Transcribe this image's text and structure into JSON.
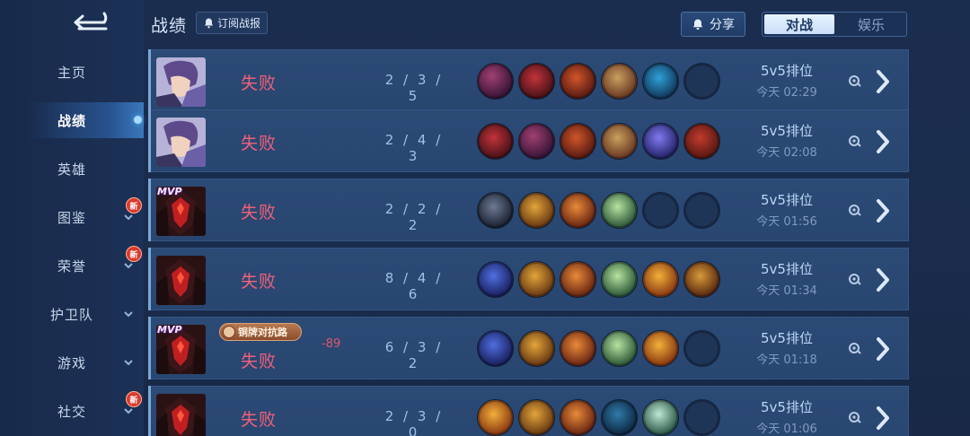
{
  "header": {
    "title": "战绩",
    "subscribe_label": "订阅战报",
    "share_label": "分享",
    "tabs": [
      {
        "label": "对战",
        "active": true
      },
      {
        "label": "娱乐",
        "active": false
      }
    ]
  },
  "sidebar": {
    "items": [
      {
        "label": "主页"
      },
      {
        "label": "战绩"
      },
      {
        "label": "英雄"
      },
      {
        "label": "图鉴",
        "badge": "新"
      },
      {
        "label": "荣誉",
        "badge": "新"
      },
      {
        "label": "护卫队"
      },
      {
        "label": "游戏"
      },
      {
        "label": "社交",
        "badge": "新"
      }
    ]
  },
  "matches": [
    {
      "result": "失败",
      "kda": "2 / 3 / 5",
      "mode": "5v5排位",
      "time": "今天 02:29",
      "hero": "swordsman",
      "mvp": false
    },
    {
      "result": "失败",
      "kda": "2 / 4 / 3",
      "mode": "5v5排位",
      "time": "今天 02:08",
      "hero": "swordsman",
      "mvp": false
    },
    {
      "result": "失败",
      "kda": "2 / 2 / 2",
      "mode": "5v5排位",
      "time": "今天 01:56",
      "hero": "dark-knight",
      "mvp": true,
      "mvp_label": "MVP"
    },
    {
      "result": "失败",
      "kda": "8 / 4 / 6",
      "mode": "5v5排位",
      "time": "今天 01:34",
      "hero": "dark-knight",
      "mvp": false
    },
    {
      "result": "失败",
      "kda": "6 / 3 / 2",
      "mode": "5v5排位",
      "time": "今天 01:18",
      "hero": "dark-knight",
      "mvp": true,
      "mvp_label": "MVP",
      "rank_badge": "铜牌对抗路",
      "score_delta": "-89"
    },
    {
      "result": "失败",
      "kda": "2 / 3 / 0",
      "mode": "5v5排位",
      "time": "今天 01:06",
      "hero": "dark-knight",
      "mvp": false
    }
  ],
  "colors": {
    "loss": "#f0607a",
    "accent": "#7aa7d6"
  }
}
